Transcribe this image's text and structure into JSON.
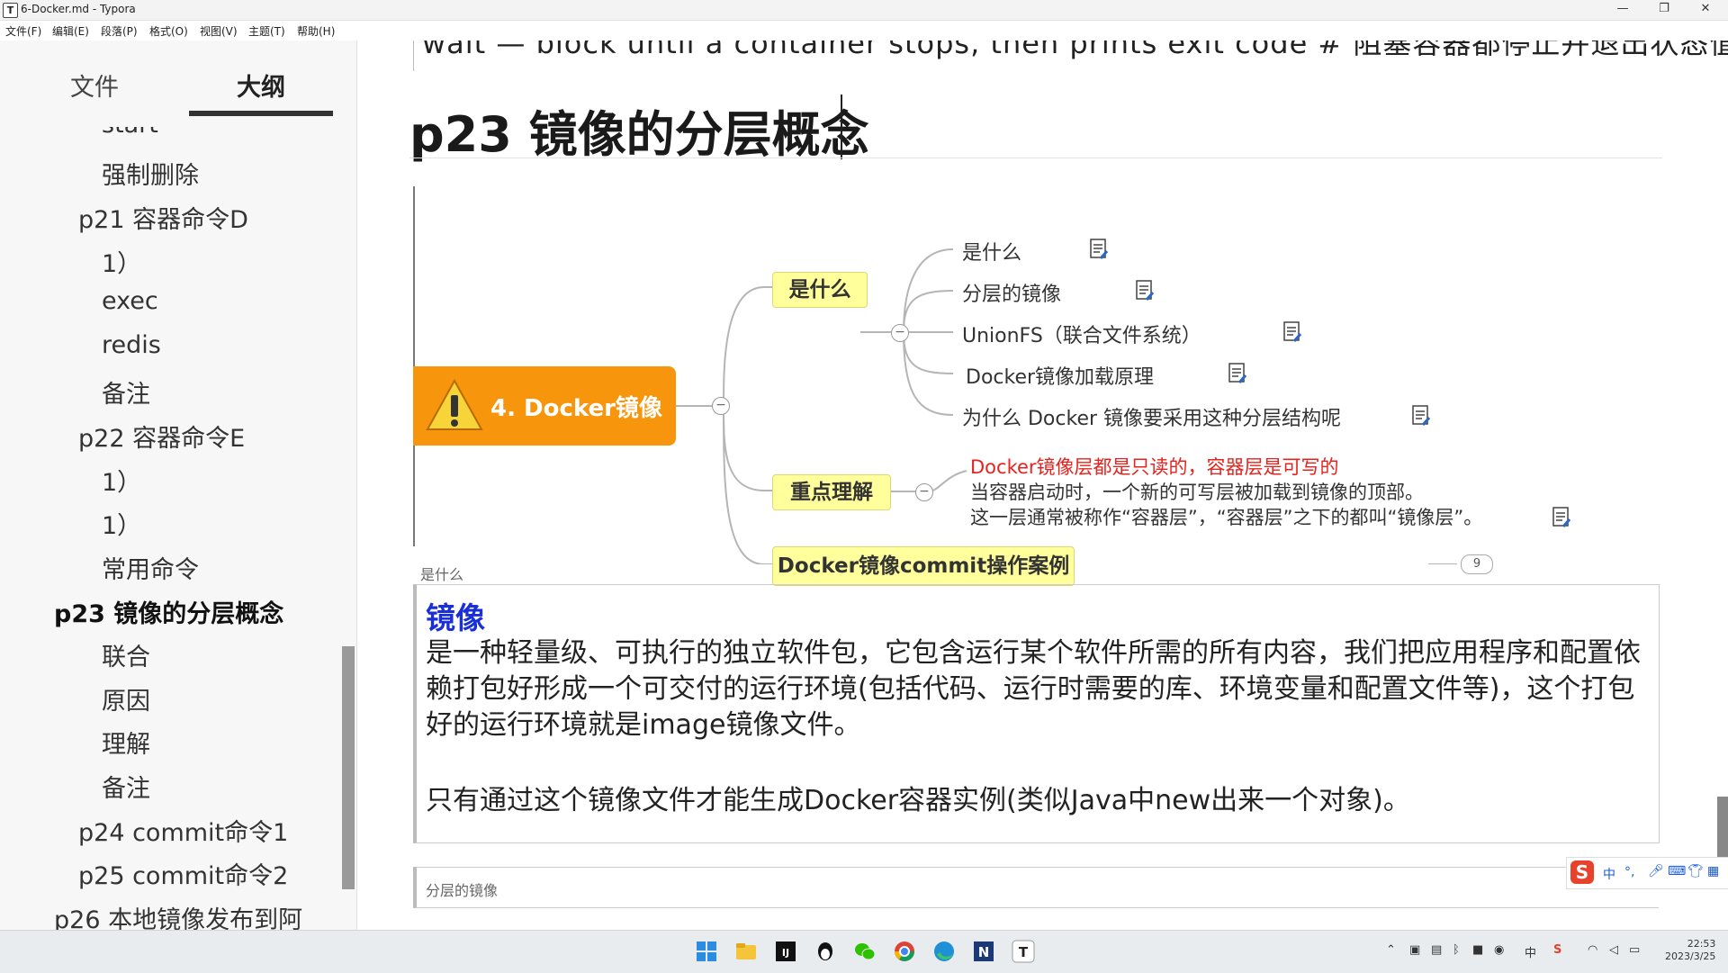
{
  "window": {
    "title": "6-Docker.md - Typora",
    "app_icon": "T",
    "controls": [
      "—",
      "❐",
      "✕"
    ]
  },
  "menu": [
    "文件(F)",
    "编辑(E)",
    "段落(P)",
    "格式(O)",
    "视图(V)",
    "主题(T)",
    "帮助(H)"
  ],
  "sidebar": {
    "tabs": [
      "文件",
      "大纲"
    ],
    "active_tab": "大纲",
    "outline": [
      {
        "label": "start",
        "level": 2
      },
      {
        "label": "强制删除",
        "level": 2
      },
      {
        "label": "p21 容器命令D",
        "level": 1
      },
      {
        "label": "1）",
        "level": 2
      },
      {
        "label": "exec",
        "level": 2
      },
      {
        "label": "redis",
        "level": 2
      },
      {
        "label": "备注",
        "level": 2
      },
      {
        "label": "p22 容器命令E",
        "level": 1
      },
      {
        "label": "1）",
        "level": 2
      },
      {
        "label": "1）",
        "level": 2
      },
      {
        "label": "常用命令",
        "level": 2
      },
      {
        "label": "p23 镜像的分层概念",
        "level": 0,
        "active": true
      },
      {
        "label": "联合",
        "level": 2
      },
      {
        "label": "原因",
        "level": 2
      },
      {
        "label": "理解",
        "level": 2
      },
      {
        "label": "备注",
        "level": 2
      },
      {
        "label": "p24 commit命令1",
        "level": 1
      },
      {
        "label": "p25 commit命令2",
        "level": 1
      },
      {
        "label": "p26 本地镜像发布到阿",
        "level": 0
      }
    ]
  },
  "doc": {
    "cut_line": "wait — block until a container stops, then prints exit code  # 阻塞容器都停止并退出状态值",
    "heading": "p23 镜像的分层概念",
    "mindmap": {
      "central": "4. Docker镜像",
      "branch1": {
        "label": "是什么",
        "leaves": [
          "是什么",
          "分层的镜像",
          "UnionFS（联合文件系统）",
          "Docker镜像加载原理",
          "为什么 Docker 镜像要采用这种分层结构呢"
        ]
      },
      "branch2": {
        "label": "重点理解",
        "red_line": "Docker镜像层都是只读的，容器层是可写的",
        "line2": "当容器启动时，一个新的可写层被加载到镜像的顶部。",
        "line3": "这一层通常被称作“容器层”，“容器层”之下的都叫“镜像层”。"
      },
      "branch3": {
        "label": "Docker镜像commit操作案例",
        "count": "9"
      },
      "collapse_symbol": "−"
    },
    "note1": {
      "head": "是什么",
      "title": "镜像",
      "para": "是一种轻量级、可执行的独立软件包，它包含运行某个软件所需的所有内容，我们把应用程序和配置依赖打包好形成一个可交付的运行环境(包括代码、运行时需要的库、环境变量和配置文件等)，这个打包好的运行环境就是image镜像文件。",
      "para2": "只有通过这个镜像文件才能生成Docker容器实例(类似Java中new出来一个对象)。"
    },
    "note2": {
      "head": "分层的镜像"
    }
  },
  "ime": {
    "lang": "中",
    "punct": "°,"
  },
  "taskbar": {
    "tray_lang": "中",
    "time": "22:53",
    "date": "2023/3/25"
  },
  "colors": {
    "central_orange": "#f7960d",
    "branch_yellow": "#ffff9b",
    "red": "#e6231e",
    "note_title_blue": "#1b2fd6"
  }
}
